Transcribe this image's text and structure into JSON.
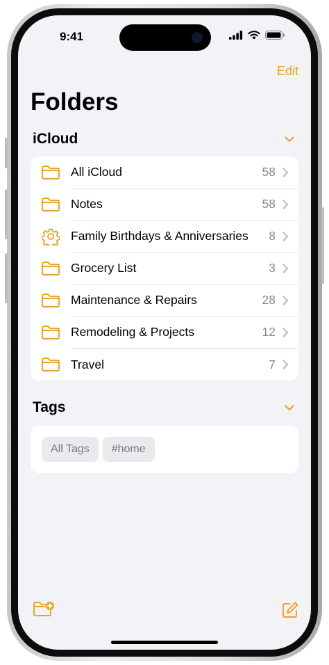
{
  "status": {
    "time": "9:41"
  },
  "nav": {
    "edit_label": "Edit"
  },
  "page": {
    "title": "Folders"
  },
  "icloud": {
    "title": "iCloud",
    "folders": [
      {
        "label": "All iCloud",
        "count": "58",
        "icon": "folder-icon"
      },
      {
        "label": "Notes",
        "count": "58",
        "icon": "folder-icon"
      },
      {
        "label": "Family Birthdays & Anniversaries",
        "count": "8",
        "icon": "gear-icon"
      },
      {
        "label": "Grocery List",
        "count": "3",
        "icon": "folder-icon"
      },
      {
        "label": "Maintenance & Repairs",
        "count": "28",
        "icon": "folder-icon"
      },
      {
        "label": "Remodeling & Projects",
        "count": "12",
        "icon": "folder-icon"
      },
      {
        "label": "Travel",
        "count": "7",
        "icon": "folder-icon"
      }
    ]
  },
  "tags": {
    "title": "Tags",
    "items": [
      "All Tags",
      "#home"
    ]
  },
  "colors": {
    "accent": "#e3a52b",
    "background": "#f2f2f7"
  }
}
